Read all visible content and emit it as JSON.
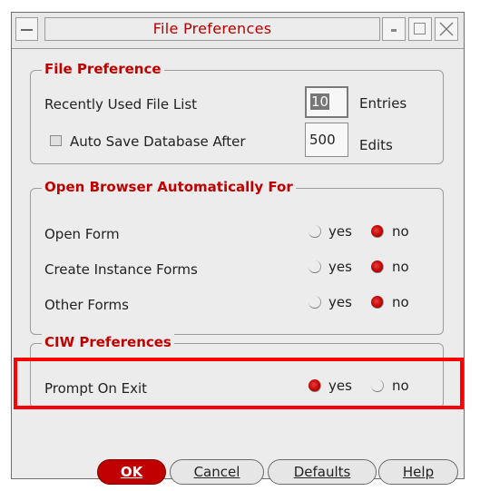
{
  "window": {
    "title": "File Preferences"
  },
  "file_preference": {
    "group_label": "File Preference",
    "recent_list_label": "Recently Used File List",
    "recent_list_value": "10",
    "recent_list_unit": "Entries",
    "auto_save_label": "Auto Save Database After",
    "auto_save_checked": false,
    "auto_save_value": "500",
    "auto_save_unit": "Edits"
  },
  "browser": {
    "group_label": "Open Browser Automatically For",
    "rows": [
      {
        "label": "Open Form",
        "yes": "yes",
        "no": "no",
        "selected": "no"
      },
      {
        "label": "Create Instance Forms",
        "yes": "yes",
        "no": "no",
        "selected": "no"
      },
      {
        "label": "Other Forms",
        "yes": "yes",
        "no": "no",
        "selected": "no"
      }
    ]
  },
  "ciw": {
    "group_label": "CIW Preferences",
    "prompt_label": "Prompt On Exit",
    "yes": "yes",
    "no": "no",
    "selected": "yes"
  },
  "buttons": {
    "ok": "OK",
    "cancel": "Cancel",
    "defaults": "Defaults",
    "help": "Help"
  },
  "icons": [
    "window-menu-icon",
    "minimize-icon",
    "maximize-icon",
    "close-icon",
    "radio-icon",
    "checkbox-icon"
  ],
  "colors": {
    "accent": "#c00000",
    "highlight_box": "#ff0000"
  }
}
